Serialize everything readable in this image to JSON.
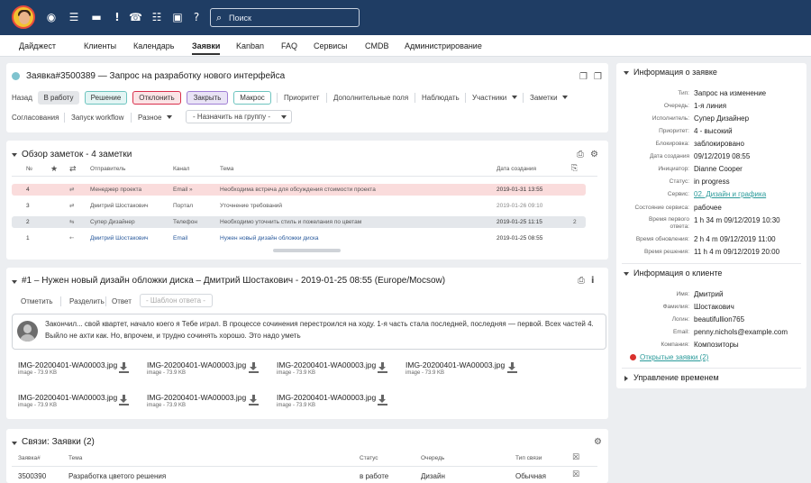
{
  "topbar": {
    "search_placeholder": "Поиск",
    "icons": [
      "eye-icon",
      "list-icon",
      "folder-icon",
      "exclamation-icon",
      "phone-icon",
      "sitemap-icon",
      "lock-icon",
      "question-icon"
    ]
  },
  "nav": {
    "items": [
      "Дайджест",
      "Клиенты",
      "Календарь",
      "Заявки",
      "Kanban",
      "FAQ",
      "Сервисы",
      "CMDB",
      "Администрирование"
    ],
    "active": "Заявки"
  },
  "ticket": {
    "title": "Заявка#3500389 — Запрос на разработку нового интерфейса",
    "actions": {
      "back": "Назад",
      "in_work": "В работу",
      "solution": "Решение",
      "reject": "Отклонить",
      "close": "Закрыть",
      "macros": "Макрос",
      "priority": "Приоритет",
      "extra_fields": "Дополнительные поля",
      "watch": "Наблюдать",
      "participants": "Участники",
      "notes": "Заметки",
      "approvals": "Согласования",
      "workflow": "Запуск workflow",
      "misc": "Разное",
      "assign_group": "- Назначить на группу -"
    }
  },
  "notes_overview": {
    "title": "Обзор заметок - 4 заметки",
    "headers": {
      "num": "№",
      "sender": "Отправитель",
      "channel": "Канал",
      "subject": "Тема",
      "date": "Дата создания"
    },
    "rows": [
      {
        "num": "4",
        "sender": "Менеджер проекта",
        "channel": "Email »",
        "subject": "Необходима встреча для обсуждения стоимости проекта",
        "date": "2019-01-31 13:55",
        "count": ""
      },
      {
        "num": "3",
        "sender": "Дмитрий Шостакович",
        "channel": "Портал",
        "subject": "Уточнение требований",
        "date": "2019-01-26 09:10",
        "count": ""
      },
      {
        "num": "2",
        "sender": "Супер Дизайнер",
        "channel": "Телефон",
        "subject": "Необходимо уточнить стиль и пожелания по цветам",
        "date": "2019-01-25 11:15",
        "count": "2"
      },
      {
        "num": "1",
        "sender": "Дмитрий Шостакович",
        "channel": "Email",
        "subject": "Нужен новый дизайн обложки диска",
        "date": "2019-01-25 08:55",
        "count": ""
      }
    ]
  },
  "article": {
    "title": "#1 – Нужен новый дизайн обложки диска – Дмитрий Шостакович - 2019-01-25 08:55 (Europe/Mocsow)",
    "actions": {
      "mark": "Отметить",
      "split": "Разделить",
      "reply": "Ответ",
      "template": "- Шаблон ответа -"
    },
    "body": "Закончил... свой квартет, начало коего я Тебе играл. В процессе сочинения перестроился на ходу. 1-я часть стала последней, последняя — первой. Всех частей 4. Выйло не ахти как. Но, впрочем, и трудно сочинять хорошо. Это надо уметь",
    "attachments": [
      {
        "name": "IMG-20200401-WA00003.jpg",
        "meta": "image - 73.9 KB"
      },
      {
        "name": "IMG-20200401-WA00003.jpg",
        "meta": "image - 73.9 KB"
      },
      {
        "name": "IMG-20200401-WA00003.jpg",
        "meta": "image - 73.9 KB"
      },
      {
        "name": "IMG-20200401-WA00003.jpg",
        "meta": "image - 73.9 KB"
      },
      {
        "name": "IMG-20200401-WA00003.jpg",
        "meta": "image - 73.9 KB"
      },
      {
        "name": "IMG-20200401-WA00003.jpg",
        "meta": "image - 73.9 KB"
      },
      {
        "name": "IMG-20200401-WA00003.jpg",
        "meta": "image - 73.9 KB"
      }
    ]
  },
  "links": {
    "title": "Связи: Заявки (2)",
    "headers": {
      "ticket": "Заявка#",
      "subject": "Тема",
      "status": "Статус",
      "queue": "Очередь",
      "link_type": "Тип связи"
    },
    "rows": [
      {
        "ticket": "3500390",
        "subject": "Разработка цветого решения",
        "status": "в работе",
        "queue": "Дизайн",
        "link_type": "Обычная"
      }
    ]
  },
  "ticket_info": {
    "title": "Информация о заявке",
    "fields": [
      {
        "key": "Тип:",
        "value": "Запрос на изменение"
      },
      {
        "key": "Очередь:",
        "value": "1-я линия"
      },
      {
        "key": "Исполнитель:",
        "value": "Супер Дизайнер"
      },
      {
        "key": "Приоритет:",
        "value": "4 - высокий"
      },
      {
        "key": "Блокировка:",
        "value": "заблокировано"
      },
      {
        "key": "Дата создания",
        "value": "09/12/2019 08:55"
      },
      {
        "key": "Инициатор:",
        "value": "Dianne Cooper"
      },
      {
        "key": "Статус:",
        "value": "in progress"
      },
      {
        "key": "Сервис:",
        "value": "02. Дизайн и графика"
      },
      {
        "key": "Состояние сервиса:",
        "value": "рабочее"
      },
      {
        "key": "Время первого ответа:",
        "value": "1 h 34 m 09/12/2019 10:30"
      },
      {
        "key": "Время обновления:",
        "value": "2 h 4 m 09/12/2019 11:00"
      },
      {
        "key": "Время решения:",
        "value": "11 h 4 m 09/12/2019 20:00"
      }
    ]
  },
  "customer_info": {
    "title": "Информация о клиенте",
    "fields": [
      {
        "key": "Имя:",
        "value": "Дмитрий"
      },
      {
        "key": "Фамилия:",
        "value": "Шостакович"
      },
      {
        "key": "Логин:",
        "value": "beautifullion765"
      },
      {
        "key": "Email:",
        "value": "penny.nichols@example.com"
      },
      {
        "key": "Компания:",
        "value": "Композиторы"
      }
    ],
    "open_tickets": "Открытые заявки (2)"
  },
  "time_mgmt": {
    "title": "Управление временем"
  },
  "colors": {
    "topbar": "#1f3d64",
    "row_highlight": "#fadcdc",
    "row_selected": "#e4e7eb",
    "link": "#2a5a9c",
    "service_link": "#2a9a9a",
    "alert": "#d9302c"
  }
}
